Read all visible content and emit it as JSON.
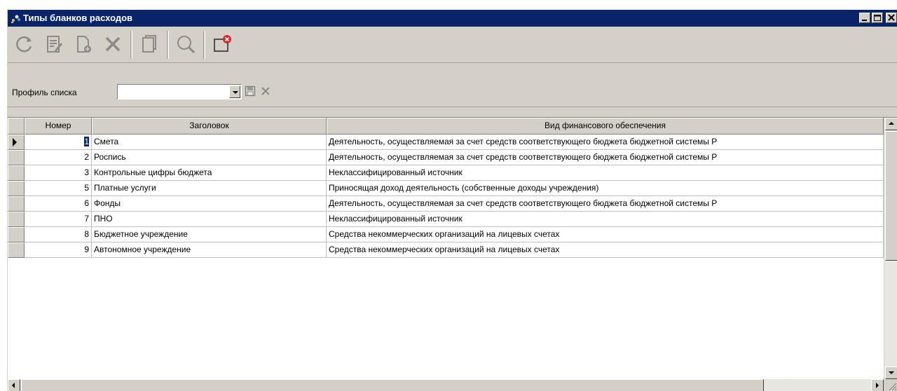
{
  "window": {
    "title": "Типы бланков расходов",
    "controls": {
      "minimize": "_",
      "maximize": "□",
      "close": "×"
    }
  },
  "toolbar": {
    "buttons": [
      {
        "name": "refresh-button",
        "icon": "refresh-icon"
      },
      {
        "name": "edit-button",
        "icon": "edit-document-icon"
      },
      {
        "name": "new-button",
        "icon": "new-document-icon"
      },
      {
        "name": "delete-button",
        "icon": "delete-icon"
      },
      {
        "name": "copy-button",
        "icon": "copy-icon"
      },
      {
        "name": "search-button",
        "icon": "search-icon"
      },
      {
        "name": "close-window-button",
        "icon": "close-window-icon"
      }
    ]
  },
  "profile": {
    "label": "Профиль списка",
    "value": ""
  },
  "table": {
    "columns": [
      "Номер",
      "Заголовок",
      "Вид финансового обеспечения"
    ],
    "rows": [
      {
        "num": "1",
        "title": "Смета",
        "vid": "Деятельность, осуществляемая за счет средств соответствующего бюджета бюджетной системы Р"
      },
      {
        "num": "2",
        "title": "Роспись",
        "vid": "Деятельность, осуществляемая за счет средств соответствующего бюджета бюджетной системы Р"
      },
      {
        "num": "3",
        "title": "Контрольные цифры бюджета",
        "vid": "Неклассифицированный источник"
      },
      {
        "num": "5",
        "title": "Платные услуги",
        "vid": "Приносящая доход деятельность (собственные доходы учреждения)"
      },
      {
        "num": "6",
        "title": "Фонды",
        "vid": "Деятельность, осуществляемая за счет средств соответствующего бюджета бюджетной системы Р"
      },
      {
        "num": "7",
        "title": "ПНО",
        "vid": "Неклассифицированный источник"
      },
      {
        "num": "8",
        "title": "Бюджетное учреждение",
        "vid": "Средства некоммерческих организаций на лицевых счетах"
      },
      {
        "num": "9",
        "title": "Автономное учреждение",
        "vid": "Средства некоммерческих организаций на лицевых счетах"
      }
    ]
  },
  "colors": {
    "titlebar": "#0a246a",
    "chrome": "#d4d0c8",
    "selection": "#0a246a"
  }
}
